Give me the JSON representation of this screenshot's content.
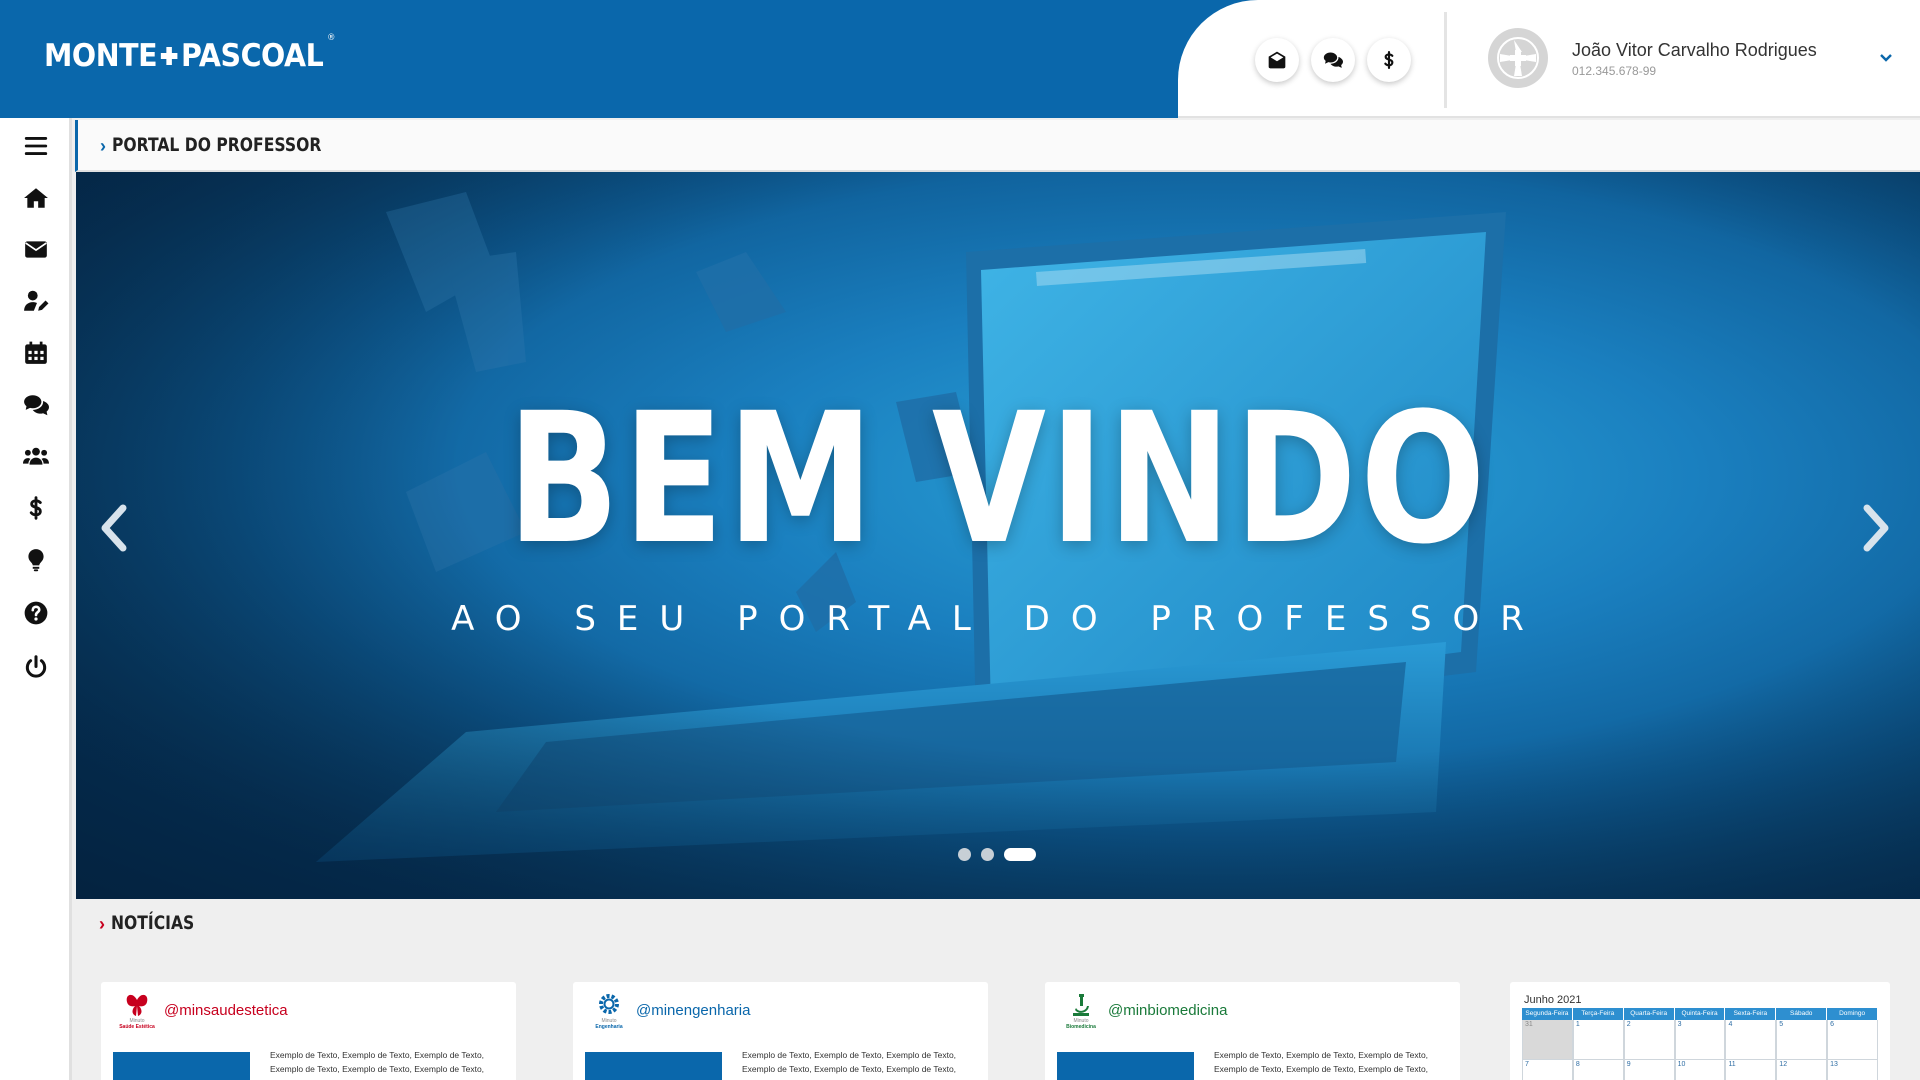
{
  "header": {
    "logo": {
      "left": "MONTE",
      "right": "PASCOAL",
      "reg": "®"
    },
    "actions": [
      {
        "name": "mail-open-icon",
        "label": "Mensagens"
      },
      {
        "name": "chat-icon",
        "label": "Chat"
      },
      {
        "name": "dollar-icon",
        "label": "Financeiro"
      }
    ],
    "user": {
      "name": "João Vitor Carvalho Rodrigues",
      "id": "012.345.678-99"
    }
  },
  "sidebar": {
    "items": [
      {
        "name": "menu-icon"
      },
      {
        "name": "home-icon"
      },
      {
        "name": "envelope-icon"
      },
      {
        "name": "user-edit-icon"
      },
      {
        "name": "calendar-icon"
      },
      {
        "name": "comments-icon"
      },
      {
        "name": "users-icon"
      },
      {
        "name": "dollar-icon"
      },
      {
        "name": "lightbulb-icon"
      },
      {
        "name": "question-icon"
      },
      {
        "name": "power-icon"
      }
    ]
  },
  "breadcrumb": {
    "title": "PORTAL DO PROFESSOR"
  },
  "hero": {
    "title": "BEM VINDO",
    "subtitle": "AO SEU PORTAL DO PROFESSOR",
    "slides": 3,
    "active_slide": 3
  },
  "news": {
    "title": "NOTÍCIAS",
    "cards": [
      {
        "handle": "@minsaudestetica",
        "brand": "Minuto",
        "brand2": "Saúde Estética",
        "color": "#c7001e",
        "text": "Exemplo de Texto, Exemplo de Texto, Exemplo de Texto, Exemplo de Texto, Exemplo de Texto, Exemplo de Texto,"
      },
      {
        "handle": "@minengenharia",
        "brand": "Minuto",
        "brand2": "Engenharia",
        "color": "#0a67ab",
        "text": "Exemplo de Texto, Exemplo de Texto, Exemplo de Texto, Exemplo de Texto, Exemplo de Texto, Exemplo de Texto,"
      },
      {
        "handle": "@minbiomedicina",
        "brand": "Minuto",
        "brand2": "Biomedicina",
        "color": "#1a7a3a",
        "text": "Exemplo de Texto, Exemplo de Texto, Exemplo de Texto, Exemplo de Texto, Exemplo de Texto, Exemplo de Texto,"
      }
    ]
  },
  "calendar": {
    "title": "Junho 2021",
    "days": [
      "Segunda-Feira",
      "Terça-Feira",
      "Quarta-Feira",
      "Quinta-Feira",
      "Sexta-Feira",
      "Sábado",
      "Domingo"
    ],
    "weeks": [
      [
        "31",
        "1",
        "2",
        "3",
        "4",
        "5",
        "6"
      ],
      [
        "7",
        "8",
        "9",
        "10",
        "11",
        "12",
        "13"
      ]
    ]
  }
}
